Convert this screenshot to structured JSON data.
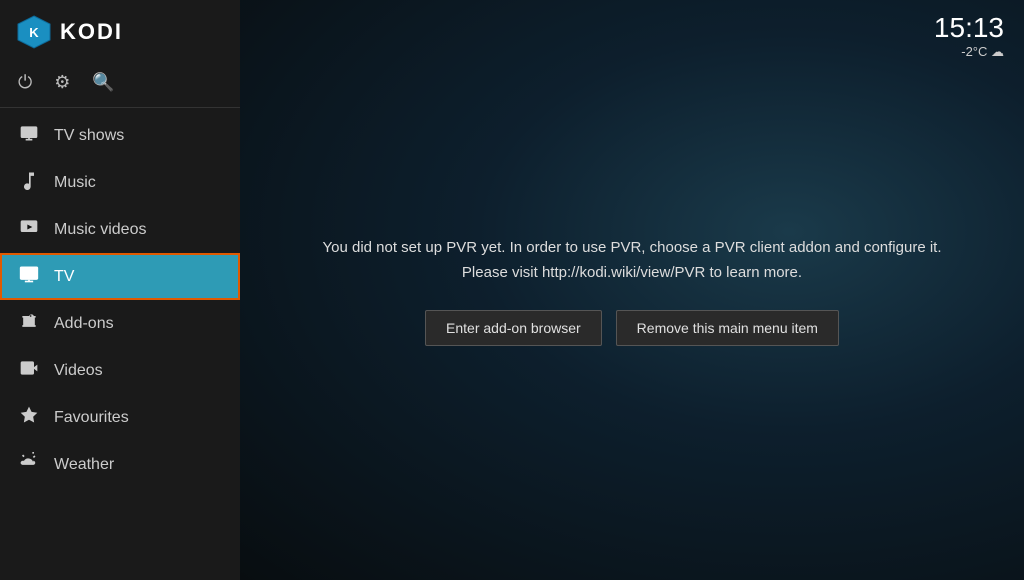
{
  "app": {
    "title": "KODI"
  },
  "clock": {
    "time": "15:13",
    "weather": "-2°C ☁"
  },
  "toolbar": {
    "power_icon": "⏻",
    "settings_icon": "⚙",
    "search_icon": "🔍"
  },
  "sidebar": {
    "items": [
      {
        "id": "tv-shows",
        "label": "TV shows",
        "icon": "tv-shows-icon",
        "active": false
      },
      {
        "id": "music",
        "label": "Music",
        "icon": "music-icon",
        "active": false
      },
      {
        "id": "music-videos",
        "label": "Music videos",
        "icon": "music-videos-icon",
        "active": false
      },
      {
        "id": "tv",
        "label": "TV",
        "icon": "tv-icon",
        "active": true
      },
      {
        "id": "add-ons",
        "label": "Add-ons",
        "icon": "addons-icon",
        "active": false
      },
      {
        "id": "videos",
        "label": "Videos",
        "icon": "videos-icon",
        "active": false
      },
      {
        "id": "favourites",
        "label": "Favourites",
        "icon": "favourites-icon",
        "active": false
      },
      {
        "id": "weather",
        "label": "Weather",
        "icon": "weather-icon",
        "active": false
      }
    ]
  },
  "pvr": {
    "message_line1": "You did not set up PVR yet. In order to use PVR, choose a PVR client addon and configure it.",
    "message_line2": "Please visit http://kodi.wiki/view/PVR to learn more.",
    "button_addon_browser": "Enter add-on browser",
    "button_remove_menu": "Remove this main menu item"
  }
}
